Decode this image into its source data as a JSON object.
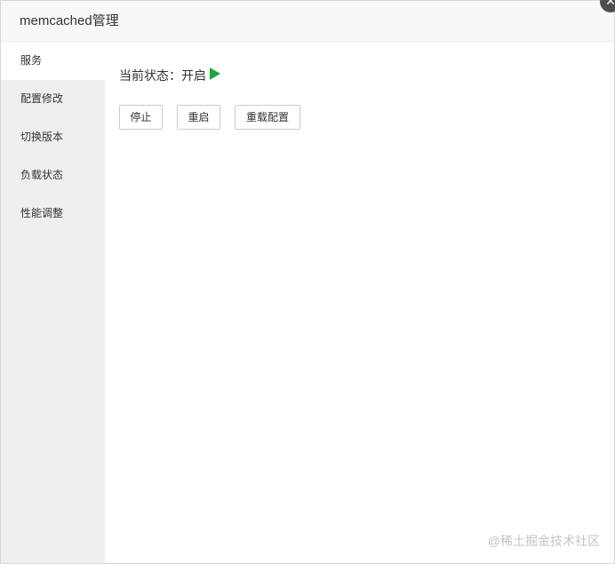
{
  "dialog": {
    "title": "memcached管理",
    "close_icon": "close-icon"
  },
  "sidebar": {
    "items": [
      {
        "label": "服务",
        "active": true
      },
      {
        "label": "配置修改",
        "active": false
      },
      {
        "label": "切换版本",
        "active": false
      },
      {
        "label": "负载状态",
        "active": false
      },
      {
        "label": "性能调整",
        "active": false
      }
    ]
  },
  "main": {
    "status_label": "当前状态：",
    "status_value": "开启",
    "status_icon": "play-icon",
    "status_color": "#20a53a",
    "buttons": {
      "stop": "停止",
      "restart": "重启",
      "reload": "重载配置"
    }
  },
  "watermark": "@稀土掘金技术社区"
}
